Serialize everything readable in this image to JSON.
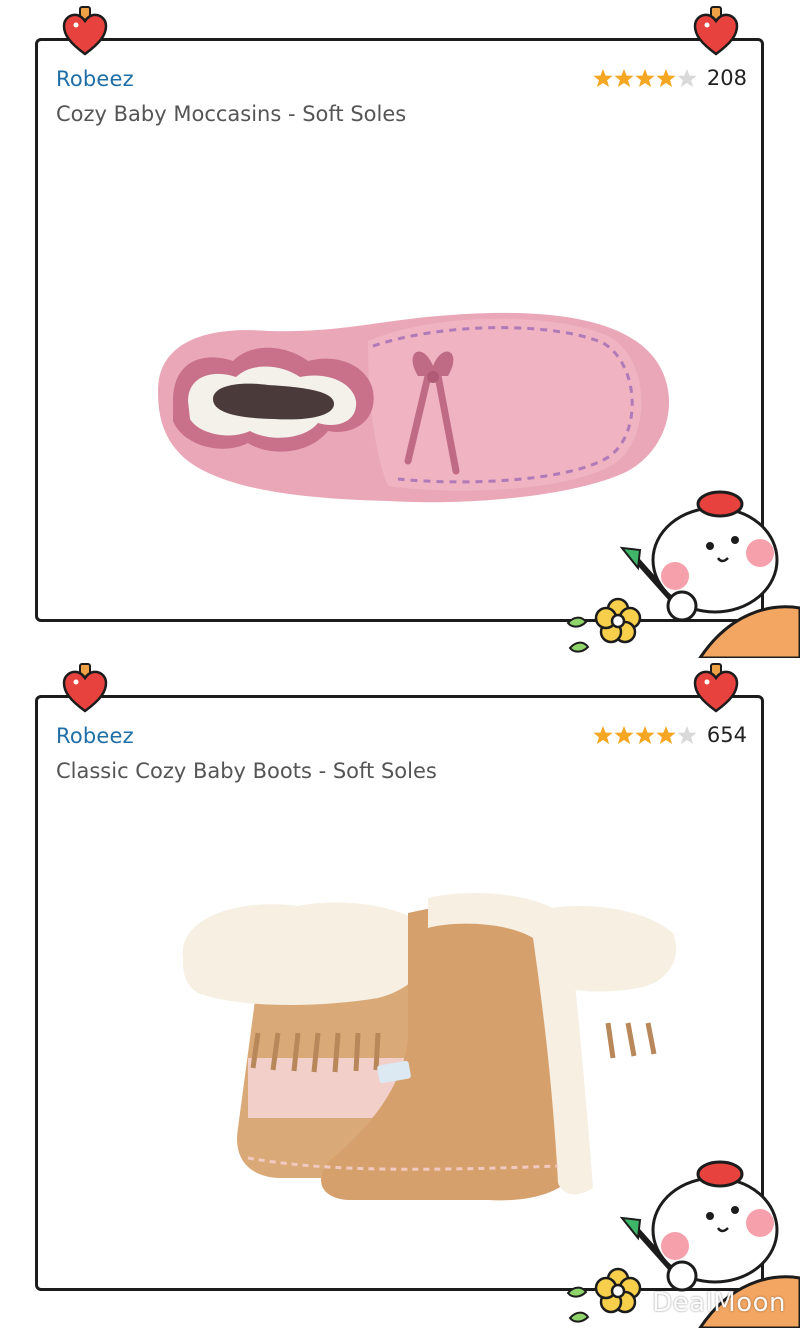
{
  "products": [
    {
      "brand": "Robeez",
      "title": "Cozy Baby Moccasins - Soft Soles",
      "rating": 4,
      "review_count": "208",
      "image": "pink-suede-moccasin"
    },
    {
      "brand": "Robeez",
      "title": "Classic Cozy Baby Boots - Soft Soles",
      "rating": 4.5,
      "review_count": "654",
      "image": "tan-fur-lined-boots"
    }
  ],
  "watermark": "DealMoon",
  "colors": {
    "brand_link": "#1f6fa6",
    "star": "#f5a623",
    "heart": "#e8423f",
    "card_border": "#1c1c1c"
  },
  "icons": [
    "heart-pin-icon",
    "star-rating-icon",
    "bear-mascot-icon",
    "flower-icon"
  ]
}
